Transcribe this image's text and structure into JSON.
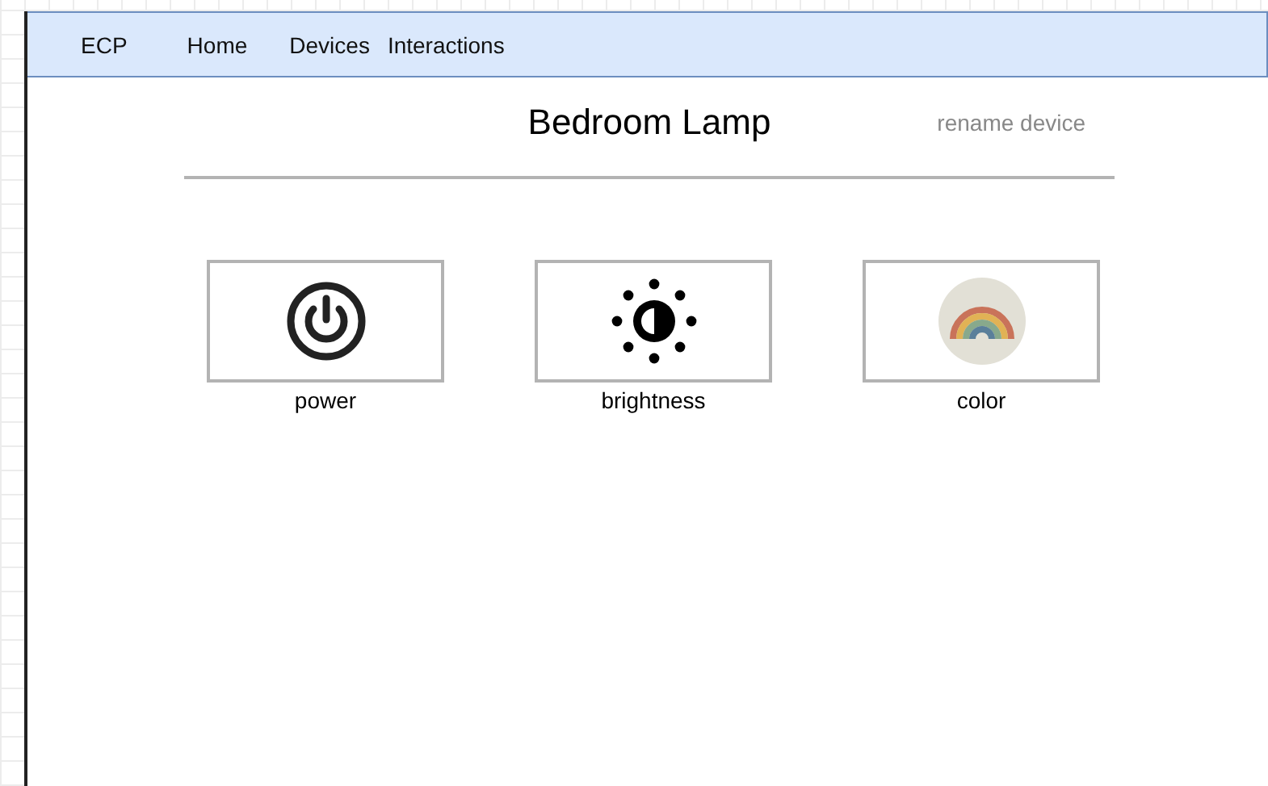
{
  "nav": {
    "brand": "ECP",
    "links": [
      "Home",
      "Devices",
      "Interactions"
    ]
  },
  "header": {
    "title": "Bedroom Lamp",
    "action": "rename device"
  },
  "controls": [
    {
      "kind": "power",
      "label": "power"
    },
    {
      "kind": "brightness",
      "label": "brightness"
    },
    {
      "kind": "color",
      "label": "color"
    }
  ]
}
